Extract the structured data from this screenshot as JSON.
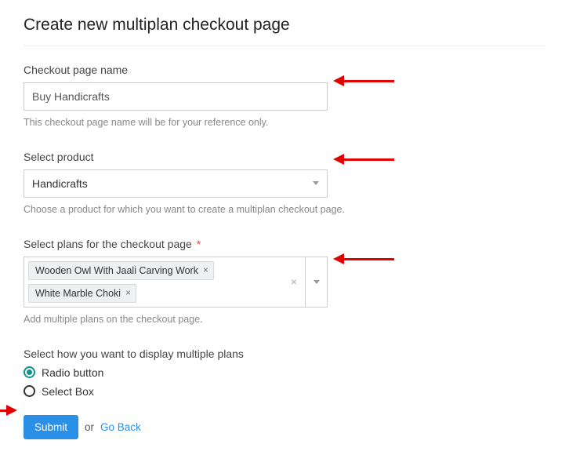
{
  "title": "Create new multiplan checkout page",
  "fields": {
    "name": {
      "label": "Checkout page name",
      "value": "Buy Handicrafts",
      "help": "This checkout page name will be for your reference only."
    },
    "product": {
      "label": "Select product",
      "value": "Handicrafts",
      "help": "Choose a product for which you want to create a multiplan checkout page."
    },
    "plans": {
      "label": "Select plans for the checkout page",
      "required": "*",
      "tags": [
        "Wooden Owl With Jaali Carving Work",
        "White Marble Choki"
      ],
      "help": "Add multiple plans on the checkout page."
    },
    "display": {
      "label": "Select how you want to display multiple plans",
      "options": [
        "Radio button",
        "Select Box"
      ]
    }
  },
  "actions": {
    "submit": "Submit",
    "or": "or",
    "back": "Go Back"
  }
}
